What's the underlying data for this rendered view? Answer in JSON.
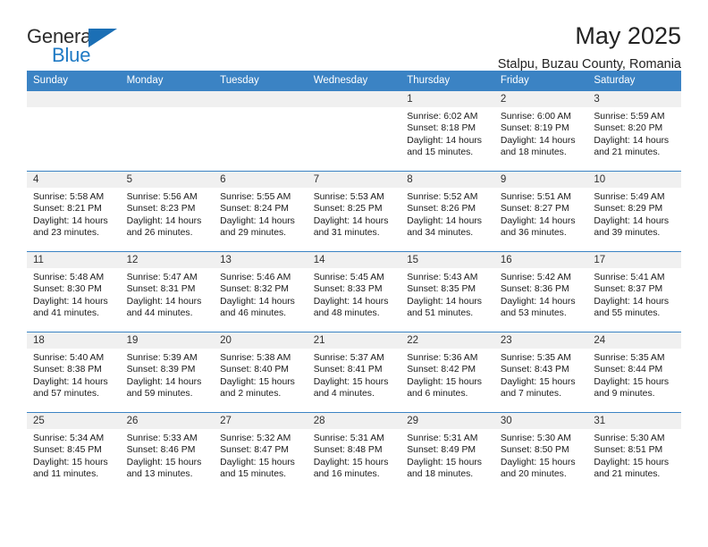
{
  "logo": {
    "text_top": "General",
    "text_bottom": "Blue",
    "triangle_color": "#1b6fb5",
    "blue_color": "#1f7ac4"
  },
  "header": {
    "title": "May 2025",
    "subtitle": "Stalpu, Buzau County, Romania"
  },
  "calendar": {
    "header_bg": "#3b83c4",
    "daynum_bg": "#f0f0f0",
    "weekdays": [
      "Sunday",
      "Monday",
      "Tuesday",
      "Wednesday",
      "Thursday",
      "Friday",
      "Saturday"
    ],
    "weeks": [
      [
        {
          "day": "",
          "lines": []
        },
        {
          "day": "",
          "lines": []
        },
        {
          "day": "",
          "lines": []
        },
        {
          "day": "",
          "lines": []
        },
        {
          "day": "1",
          "lines": [
            "Sunrise: 6:02 AM",
            "Sunset: 8:18 PM",
            "Daylight: 14 hours",
            "and 15 minutes."
          ]
        },
        {
          "day": "2",
          "lines": [
            "Sunrise: 6:00 AM",
            "Sunset: 8:19 PM",
            "Daylight: 14 hours",
            "and 18 minutes."
          ]
        },
        {
          "day": "3",
          "lines": [
            "Sunrise: 5:59 AM",
            "Sunset: 8:20 PM",
            "Daylight: 14 hours",
            "and 21 minutes."
          ]
        }
      ],
      [
        {
          "day": "4",
          "lines": [
            "Sunrise: 5:58 AM",
            "Sunset: 8:21 PM",
            "Daylight: 14 hours",
            "and 23 minutes."
          ]
        },
        {
          "day": "5",
          "lines": [
            "Sunrise: 5:56 AM",
            "Sunset: 8:23 PM",
            "Daylight: 14 hours",
            "and 26 minutes."
          ]
        },
        {
          "day": "6",
          "lines": [
            "Sunrise: 5:55 AM",
            "Sunset: 8:24 PM",
            "Daylight: 14 hours",
            "and 29 minutes."
          ]
        },
        {
          "day": "7",
          "lines": [
            "Sunrise: 5:53 AM",
            "Sunset: 8:25 PM",
            "Daylight: 14 hours",
            "and 31 minutes."
          ]
        },
        {
          "day": "8",
          "lines": [
            "Sunrise: 5:52 AM",
            "Sunset: 8:26 PM",
            "Daylight: 14 hours",
            "and 34 minutes."
          ]
        },
        {
          "day": "9",
          "lines": [
            "Sunrise: 5:51 AM",
            "Sunset: 8:27 PM",
            "Daylight: 14 hours",
            "and 36 minutes."
          ]
        },
        {
          "day": "10",
          "lines": [
            "Sunrise: 5:49 AM",
            "Sunset: 8:29 PM",
            "Daylight: 14 hours",
            "and 39 minutes."
          ]
        }
      ],
      [
        {
          "day": "11",
          "lines": [
            "Sunrise: 5:48 AM",
            "Sunset: 8:30 PM",
            "Daylight: 14 hours",
            "and 41 minutes."
          ]
        },
        {
          "day": "12",
          "lines": [
            "Sunrise: 5:47 AM",
            "Sunset: 8:31 PM",
            "Daylight: 14 hours",
            "and 44 minutes."
          ]
        },
        {
          "day": "13",
          "lines": [
            "Sunrise: 5:46 AM",
            "Sunset: 8:32 PM",
            "Daylight: 14 hours",
            "and 46 minutes."
          ]
        },
        {
          "day": "14",
          "lines": [
            "Sunrise: 5:45 AM",
            "Sunset: 8:33 PM",
            "Daylight: 14 hours",
            "and 48 minutes."
          ]
        },
        {
          "day": "15",
          "lines": [
            "Sunrise: 5:43 AM",
            "Sunset: 8:35 PM",
            "Daylight: 14 hours",
            "and 51 minutes."
          ]
        },
        {
          "day": "16",
          "lines": [
            "Sunrise: 5:42 AM",
            "Sunset: 8:36 PM",
            "Daylight: 14 hours",
            "and 53 minutes."
          ]
        },
        {
          "day": "17",
          "lines": [
            "Sunrise: 5:41 AM",
            "Sunset: 8:37 PM",
            "Daylight: 14 hours",
            "and 55 minutes."
          ]
        }
      ],
      [
        {
          "day": "18",
          "lines": [
            "Sunrise: 5:40 AM",
            "Sunset: 8:38 PM",
            "Daylight: 14 hours",
            "and 57 minutes."
          ]
        },
        {
          "day": "19",
          "lines": [
            "Sunrise: 5:39 AM",
            "Sunset: 8:39 PM",
            "Daylight: 14 hours",
            "and 59 minutes."
          ]
        },
        {
          "day": "20",
          "lines": [
            "Sunrise: 5:38 AM",
            "Sunset: 8:40 PM",
            "Daylight: 15 hours",
            "and 2 minutes."
          ]
        },
        {
          "day": "21",
          "lines": [
            "Sunrise: 5:37 AM",
            "Sunset: 8:41 PM",
            "Daylight: 15 hours",
            "and 4 minutes."
          ]
        },
        {
          "day": "22",
          "lines": [
            "Sunrise: 5:36 AM",
            "Sunset: 8:42 PM",
            "Daylight: 15 hours",
            "and 6 minutes."
          ]
        },
        {
          "day": "23",
          "lines": [
            "Sunrise: 5:35 AM",
            "Sunset: 8:43 PM",
            "Daylight: 15 hours",
            "and 7 minutes."
          ]
        },
        {
          "day": "24",
          "lines": [
            "Sunrise: 5:35 AM",
            "Sunset: 8:44 PM",
            "Daylight: 15 hours",
            "and 9 minutes."
          ]
        }
      ],
      [
        {
          "day": "25",
          "lines": [
            "Sunrise: 5:34 AM",
            "Sunset: 8:45 PM",
            "Daylight: 15 hours",
            "and 11 minutes."
          ]
        },
        {
          "day": "26",
          "lines": [
            "Sunrise: 5:33 AM",
            "Sunset: 8:46 PM",
            "Daylight: 15 hours",
            "and 13 minutes."
          ]
        },
        {
          "day": "27",
          "lines": [
            "Sunrise: 5:32 AM",
            "Sunset: 8:47 PM",
            "Daylight: 15 hours",
            "and 15 minutes."
          ]
        },
        {
          "day": "28",
          "lines": [
            "Sunrise: 5:31 AM",
            "Sunset: 8:48 PM",
            "Daylight: 15 hours",
            "and 16 minutes."
          ]
        },
        {
          "day": "29",
          "lines": [
            "Sunrise: 5:31 AM",
            "Sunset: 8:49 PM",
            "Daylight: 15 hours",
            "and 18 minutes."
          ]
        },
        {
          "day": "30",
          "lines": [
            "Sunrise: 5:30 AM",
            "Sunset: 8:50 PM",
            "Daylight: 15 hours",
            "and 20 minutes."
          ]
        },
        {
          "day": "31",
          "lines": [
            "Sunrise: 5:30 AM",
            "Sunset: 8:51 PM",
            "Daylight: 15 hours",
            "and 21 minutes."
          ]
        }
      ]
    ]
  }
}
